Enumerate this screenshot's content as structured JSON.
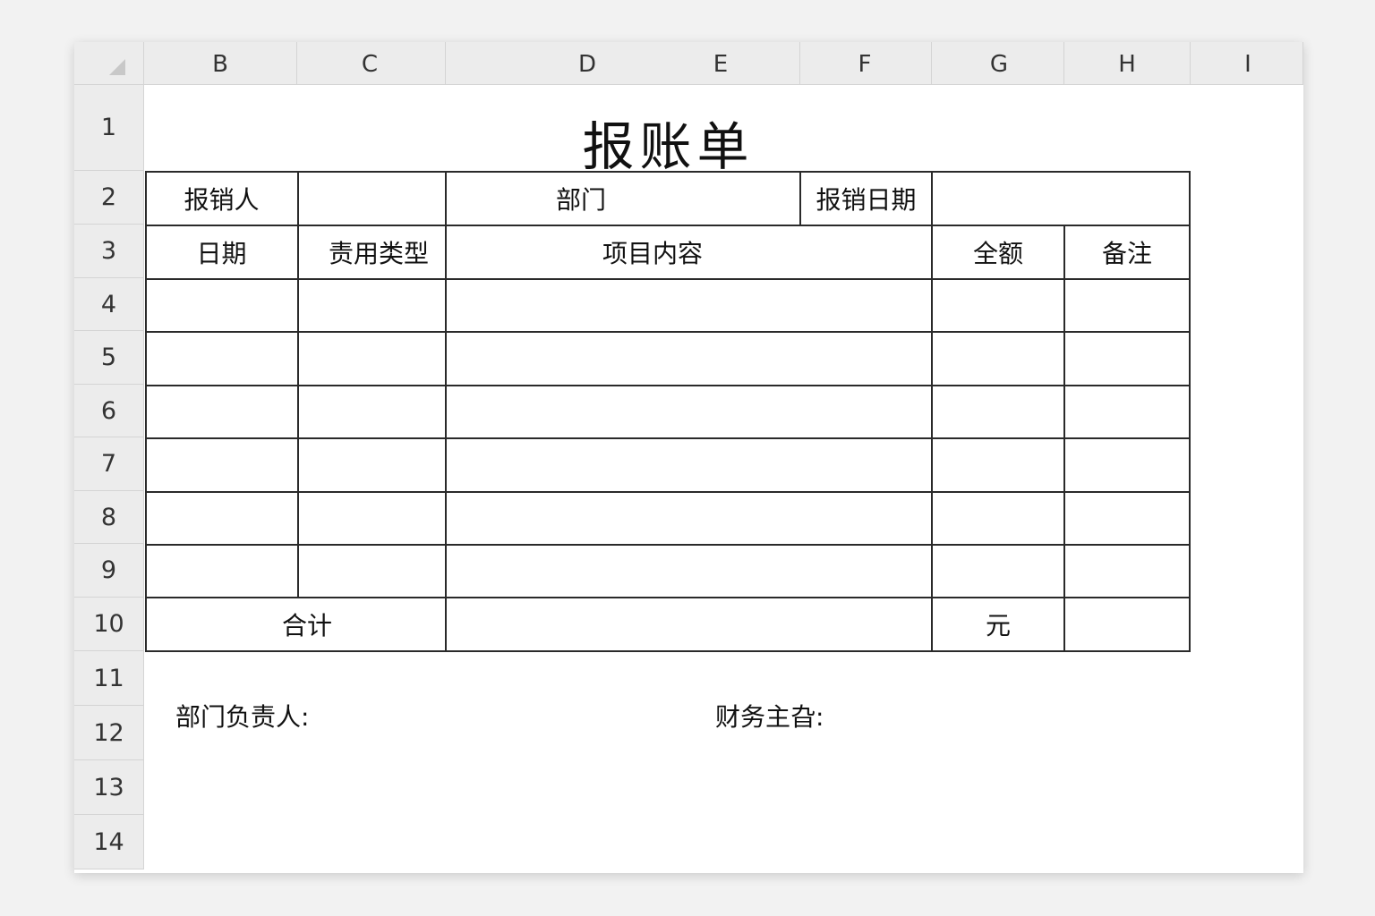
{
  "columns": [
    "B",
    "C",
    "D",
    "E",
    "F",
    "G",
    "H",
    "I"
  ],
  "rows": [
    "1",
    "2",
    "3",
    "4",
    "5",
    "6",
    "7",
    "8",
    "9",
    "10",
    "11",
    "12",
    "13",
    "14"
  ],
  "form": {
    "title": "报账单",
    "header_row": {
      "reporter_label": "报销人",
      "department_label": "部门",
      "date_label": "报销日期"
    },
    "table_headers": {
      "date": "日期",
      "expense_type": "责用类型",
      "item": "项目内容",
      "amount": "全额",
      "remark": "备注"
    },
    "total_label": "合计",
    "currency_unit": "元",
    "signatures": {
      "dept_head": "部门负责人:",
      "finance": "财务主旮:"
    }
  }
}
